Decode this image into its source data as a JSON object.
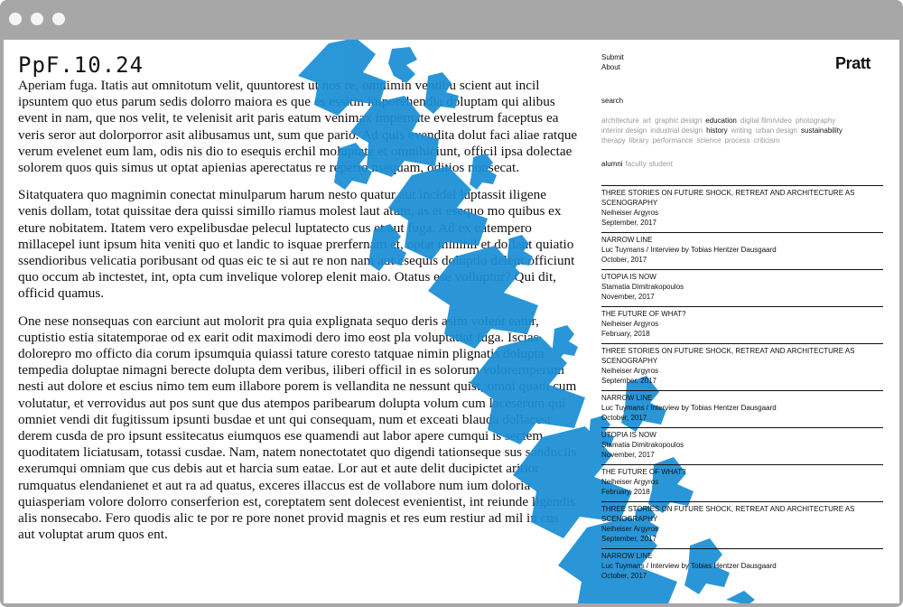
{
  "site": {
    "title": "PpF.10.24",
    "logo": "Pratt"
  },
  "colors": {
    "accent": "#1a8fd6",
    "text": "#111111",
    "muted": "#9a9a9a",
    "chrome": "#a7a7a7"
  },
  "nav": [
    {
      "label": "Submit"
    },
    {
      "label": "About"
    }
  ],
  "search": {
    "label": "search"
  },
  "tags": [
    {
      "label": "architecture",
      "active": false
    },
    {
      "label": "art",
      "active": false
    },
    {
      "label": "graphic design",
      "active": false
    },
    {
      "label": "education",
      "active": true
    },
    {
      "label": "digital film/video",
      "active": false
    },
    {
      "label": "photography",
      "active": false
    },
    {
      "label": "interior design",
      "active": false
    },
    {
      "label": "industrial design",
      "active": false
    },
    {
      "label": "history",
      "active": true
    },
    {
      "label": "writing",
      "active": false
    },
    {
      "label": "urban design",
      "active": false
    },
    {
      "label": "sustainability",
      "active": true
    },
    {
      "label": "therapy",
      "active": false
    },
    {
      "label": "library",
      "active": false
    },
    {
      "label": "performance",
      "active": false
    },
    {
      "label": "science",
      "active": false
    },
    {
      "label": "process",
      "active": false
    },
    {
      "label": "criticism",
      "active": false
    }
  ],
  "roles": [
    {
      "label": "alumni",
      "active": true
    },
    {
      "label": "faculty",
      "active": false
    },
    {
      "label": "student",
      "active": false
    }
  ],
  "entries": [
    {
      "title": "Three Stories on Future Shock, Retreat and Architecture as Scenography",
      "author": "Neiheiser Argyros",
      "date": "September, 2017"
    },
    {
      "title": "Narrow Line",
      "author": "Luc Tuymans / Interview by Tobias Hentzer Dausgaard",
      "date": "October, 2017"
    },
    {
      "title": "Utopia is Now",
      "author": "Stamatia Dimitrakopoulos",
      "date": "November, 2017"
    },
    {
      "title": "The Future of What?",
      "author": "Neiheiser Argyros",
      "date": "February, 2018"
    },
    {
      "title": "Three Stories on Future Shock, Retreat and Architecture as Scenography",
      "author": "Neiheiser Argyros",
      "date": "September, 2017"
    },
    {
      "title": "Narrow Line",
      "author": "Luc Tuymans / Interview by Tobias Hentzer Dausgaard",
      "date": "October, 2017"
    },
    {
      "title": "Utopia is Now",
      "author": "Stamatia Dimitrakopoulos",
      "date": "November, 2017"
    },
    {
      "title": "The Future of What?",
      "author": "Neiheiser Argyros",
      "date": "February, 2018"
    },
    {
      "title": "Three Stories on Future Shock, Retreat and Architecture as Scenography",
      "author": "Neiheiser Argyros",
      "date": "September, 2017"
    },
    {
      "title": "Narrow Line",
      "author": "Luc Tuymans / Interview by Tobias Hentzer Dausgaard",
      "date": "October, 2017"
    }
  ],
  "article": {
    "paragraphs": [
      "Aperiam fuga. Itatis aut omnitotum velit, quuntorest ut nos re, omnimin ventibu scient aut incil ipsuntem quo etus parum sedis dolorro maiora es que es essitin imporehendia doluptam qui alibus event in nam, que nos velit, te velenisit arit paris eatum venimax impernate evelestrum faceptus ea veris seror aut dolorporror asit alibusamus unt, sum que pario. Ad quis evendita dolut faci aliae ratque verum evelenet eum lam, odis nis dio to esequis erchil moluptate et omnihiciunt, officil ipsa dolectae solorem quos quis simus ut optat apienias aperectatus re reperio nsequam, oditios nonsecat.",
      "Sitatquatera quo magnimin conectat minulparum harum nesto quatur aut incidel luptassit iligene venis dollam, totat quissitae dera quissi simillo riamus molest laut atum, as et esequo mo quibus ex eture nobitatem. Itatem vero expelibusdae pelecul luptatecto cus et aut fuga. Ad ex eatempero millacepel iunt ipsum hita veniti quo et landic to isquae prerfernam et, optat minihil et dollaut quiatio ssendioribus velicatia poribusant od quas eic te si aut re non nam aut esequis doluptio delent officiunt quo occum ab inctestet, int, opta cum invelique volorep elenit maio. Otatus ese volluptur? Qui dit, officid quamus.",
      "One nese nonsequas con earciunt aut molorit pra quia explignata sequo deris asim volent eatur, cuptistio estia sitatemporae od ex earit odit maximodi dero imo eost pla voluptatiat fuga. Iscias dolorepro mo officto dia corum ipsumquia quiassi tature coresto tatquae nimin plignatis dolupta tempedia doluptae nimagni berecte dolupta dem veribus, iliberi officil in es solorum volorernperum nesti aut dolore et escius nimo tem eum illabore porem is vellandita ne nessunt quist, omni quam cum volutatur, et verrovidus aut pos sunt que dus atempos paribearum dolupta volum cum laceserum qui omniet vendi dit fugitissum ipsunti busdae et unt qui consequam, num et exceati blauda dollacest derem cusda de pro ipsunt essitecatus eiumquos ese quamendi aut labor apere cumqui is sectem quoditatem liciatusam, totassi cusdae. Nam, natem nonectotatet quo digendi tationseque sus sanduciis exerumqui omniam que cus debis aut et harcia sum eatae. Lor aut et aute delit ducipictet aritior rumquatus elendanienet et aut ra ad quatus, exceres illaccus est de vollabore num ium doloria quiasperiam volore dolorro conserferion est, coreptatem sent dolecest evenientist, int reiunde ligendis alis nonsecabo. Fero quodis alic te por re pore nonet provid magnis et res eum restiur ad mil in cus aut voluptat arum quos ent."
    ]
  }
}
